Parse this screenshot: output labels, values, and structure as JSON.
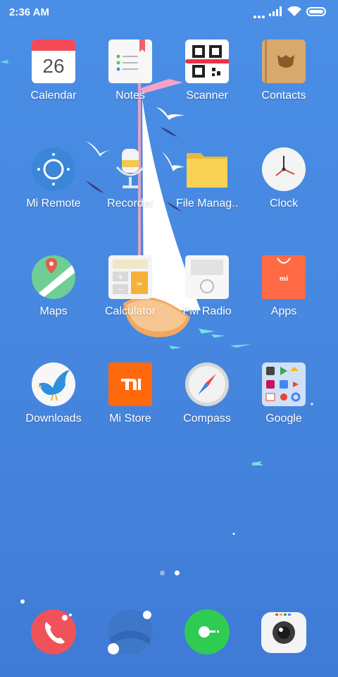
{
  "status": {
    "time": "2:36 AM"
  },
  "apps": [
    {
      "label": "Calendar",
      "icon": "calendar-icon",
      "day": "26"
    },
    {
      "label": "Notes",
      "icon": "notes-icon"
    },
    {
      "label": "Scanner",
      "icon": "qr-scanner-icon"
    },
    {
      "label": "Contacts",
      "icon": "contacts-icon"
    },
    {
      "label": "Mi Remote",
      "icon": "remote-icon"
    },
    {
      "label": "Recorder",
      "icon": "microphone-icon"
    },
    {
      "label": "File Manag..",
      "icon": "folder-icon"
    },
    {
      "label": "Clock",
      "icon": "clock-icon"
    },
    {
      "label": "Maps",
      "icon": "map-icon"
    },
    {
      "label": "Calculator",
      "icon": "calculator-icon"
    },
    {
      "label": "FM Radio",
      "icon": "radio-icon"
    },
    {
      "label": "Apps",
      "icon": "shopping-bag-icon"
    },
    {
      "label": "Downloads",
      "icon": "bird-icon"
    },
    {
      "label": "Mi Store",
      "icon": "mi-logo-icon"
    },
    {
      "label": "Compass",
      "icon": "compass-icon"
    },
    {
      "label": "Google",
      "icon": "google-folder-icon"
    }
  ],
  "dock": [
    {
      "name": "phone",
      "icon": "phone-icon"
    },
    {
      "name": "browser",
      "icon": "globe-icon"
    },
    {
      "name": "messaging",
      "icon": "message-icon"
    },
    {
      "name": "camera",
      "icon": "camera-icon"
    }
  ],
  "pager": {
    "pages": 2,
    "current": 2
  },
  "colors": {
    "accent_orange": "#ff6a2a",
    "phone_red": "#f0525a",
    "messaging_green": "#2fcb52"
  }
}
